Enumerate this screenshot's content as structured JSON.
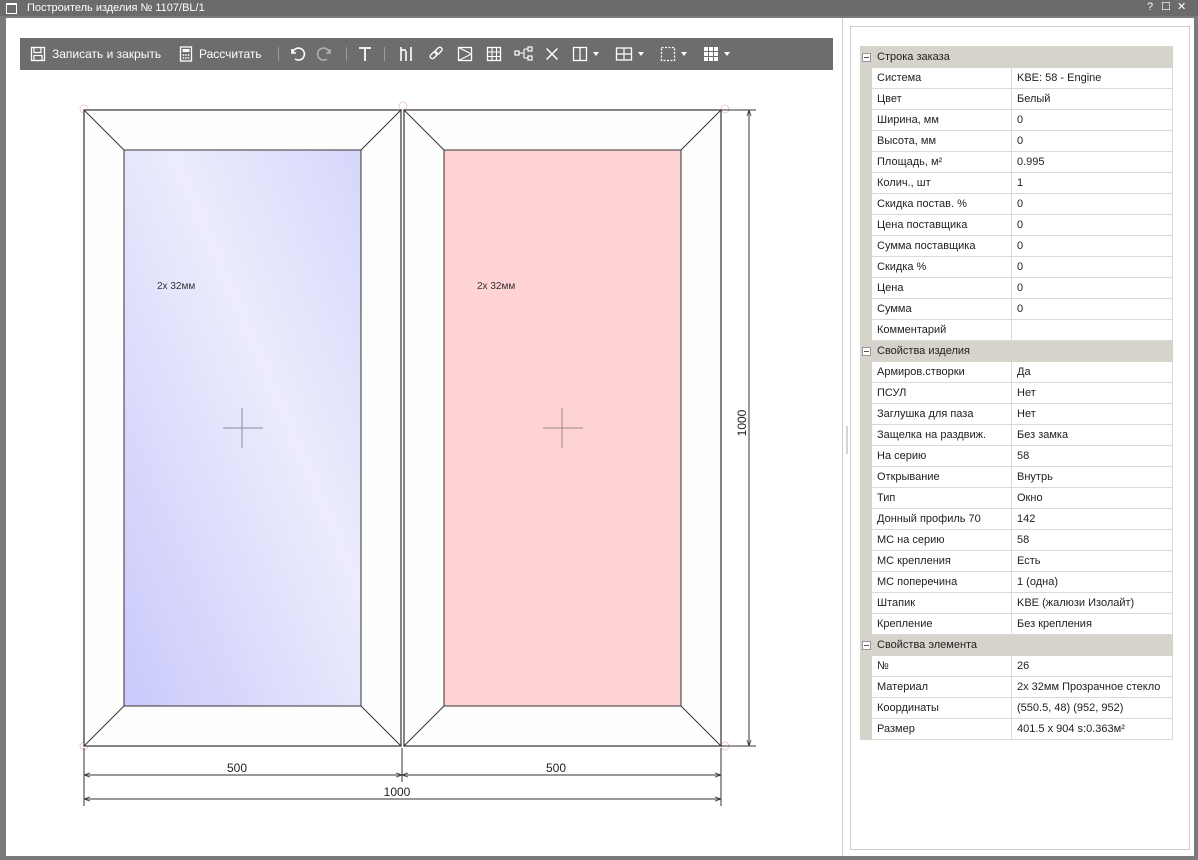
{
  "window": {
    "title": "Построитель изделия № 1107/BL/1",
    "help_label": "?",
    "maximize_label": "☐",
    "close_label": "✕"
  },
  "toolbar": {
    "save_close_label": "Записать и закрыть",
    "calculate_label": "Рассчитать"
  },
  "drawing": {
    "sashes": [
      {
        "glass_label": "2x 32мм",
        "color": "#ddddfb"
      },
      {
        "glass_label": "2x 32мм",
        "color": "#ffd2d4"
      }
    ],
    "dim_width_left": "500",
    "dim_width_right": "500",
    "dim_width_total": "1000",
    "dim_height": "1000"
  },
  "properties": {
    "groups": [
      {
        "title": "Строка заказа",
        "rows": [
          {
            "key": "Система",
            "value": "KBE: 58 - Engine"
          },
          {
            "key": "Цвет",
            "value": "Белый"
          },
          {
            "key": "Ширина, мм",
            "value": "0"
          },
          {
            "key": "Высота, мм",
            "value": "0"
          },
          {
            "key": "Площадь, м²",
            "value": "0.995"
          },
          {
            "key": "Колич., шт",
            "value": "1"
          },
          {
            "key": "Скидка постав. %",
            "value": "0"
          },
          {
            "key": "Цена поставщика",
            "value": "0"
          },
          {
            "key": "Сумма поставщика",
            "value": "0"
          },
          {
            "key": "Скидка %",
            "value": "0"
          },
          {
            "key": "Цена",
            "value": "0"
          },
          {
            "key": "Сумма",
            "value": "0"
          },
          {
            "key": "Комментарий",
            "value": ""
          }
        ]
      },
      {
        "title": "Свойства изделия",
        "rows": [
          {
            "key": "Армиров.створки",
            "value": "Да"
          },
          {
            "key": "ПСУЛ",
            "value": "Нет"
          },
          {
            "key": "Заглушка для паза",
            "value": "Нет"
          },
          {
            "key": "Защелка на раздвиж.",
            "value": "Без замка"
          },
          {
            "key": "На серию",
            "value": "58"
          },
          {
            "key": "Открывание",
            "value": "Внутрь"
          },
          {
            "key": "Тип",
            "value": "Окно"
          },
          {
            "key": "Донный профиль 70",
            "value": "142"
          },
          {
            "key": "МС на серию",
            "value": "58"
          },
          {
            "key": "МС крепления",
            "value": "Есть"
          },
          {
            "key": "МС поперечина",
            "value": "1 (одна)"
          },
          {
            "key": "Штапик",
            "value": "KBE (жалюзи Изолайт)"
          },
          {
            "key": "Крепление",
            "value": "Без крепления"
          }
        ]
      },
      {
        "title": "Свойства элемента",
        "rows": [
          {
            "key": "№",
            "value": "26"
          },
          {
            "key": "Материал",
            "value": "2x 32мм Прозрачное стекло"
          },
          {
            "key": "Координаты",
            "value": "(550.5, 48) (952, 952)"
          },
          {
            "key": "Размер",
            "value": "401.5 x 904  s:0.363м²"
          }
        ]
      }
    ]
  }
}
